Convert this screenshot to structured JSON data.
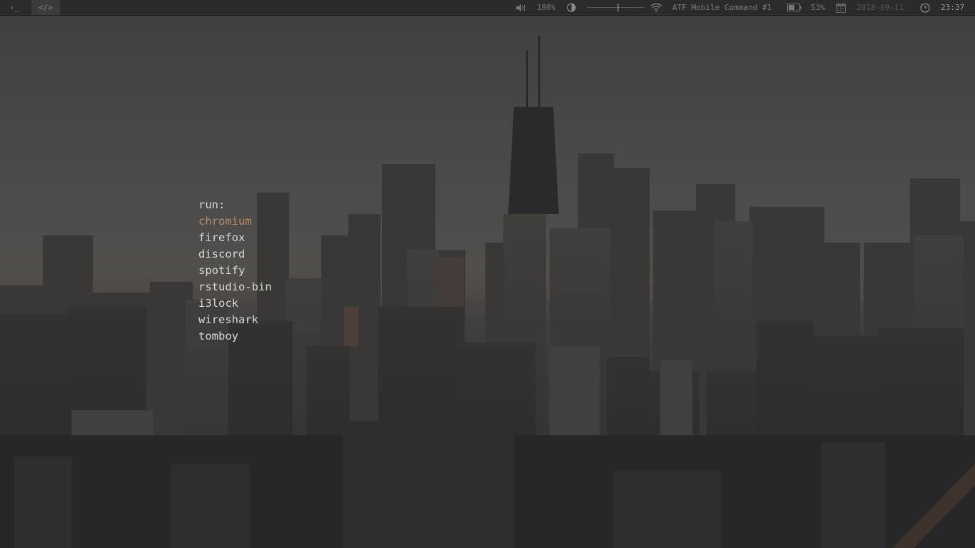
{
  "topbar": {
    "workspaces": [
      {
        "label": "›_",
        "icon": "terminal-icon"
      },
      {
        "label": "</>",
        "icon": "code-icon"
      }
    ],
    "volume": {
      "icon": "speaker-icon",
      "text": "100%"
    },
    "brightness": {
      "icon": "brightness-icon",
      "level": 0.55
    },
    "wifi": {
      "icon": "wifi-icon",
      "ssid": "ATF Mobile Command #1"
    },
    "battery": {
      "icon": "battery-icon",
      "text": "53%",
      "level": 0.53
    },
    "date": {
      "icon": "calendar-icon",
      "text": "2018-09-11"
    },
    "clock": {
      "icon": "clock-icon",
      "text": "23:37"
    }
  },
  "run_menu": {
    "prompt": "run:",
    "items": [
      "chromium",
      "firefox",
      "discord",
      "spotify",
      "rstudio-bin",
      "i3lock",
      "wireshark",
      "tomboy"
    ],
    "selected": "chromium",
    "colors": {
      "text": "#d8d8d8",
      "selected": "#b58d6e"
    }
  }
}
